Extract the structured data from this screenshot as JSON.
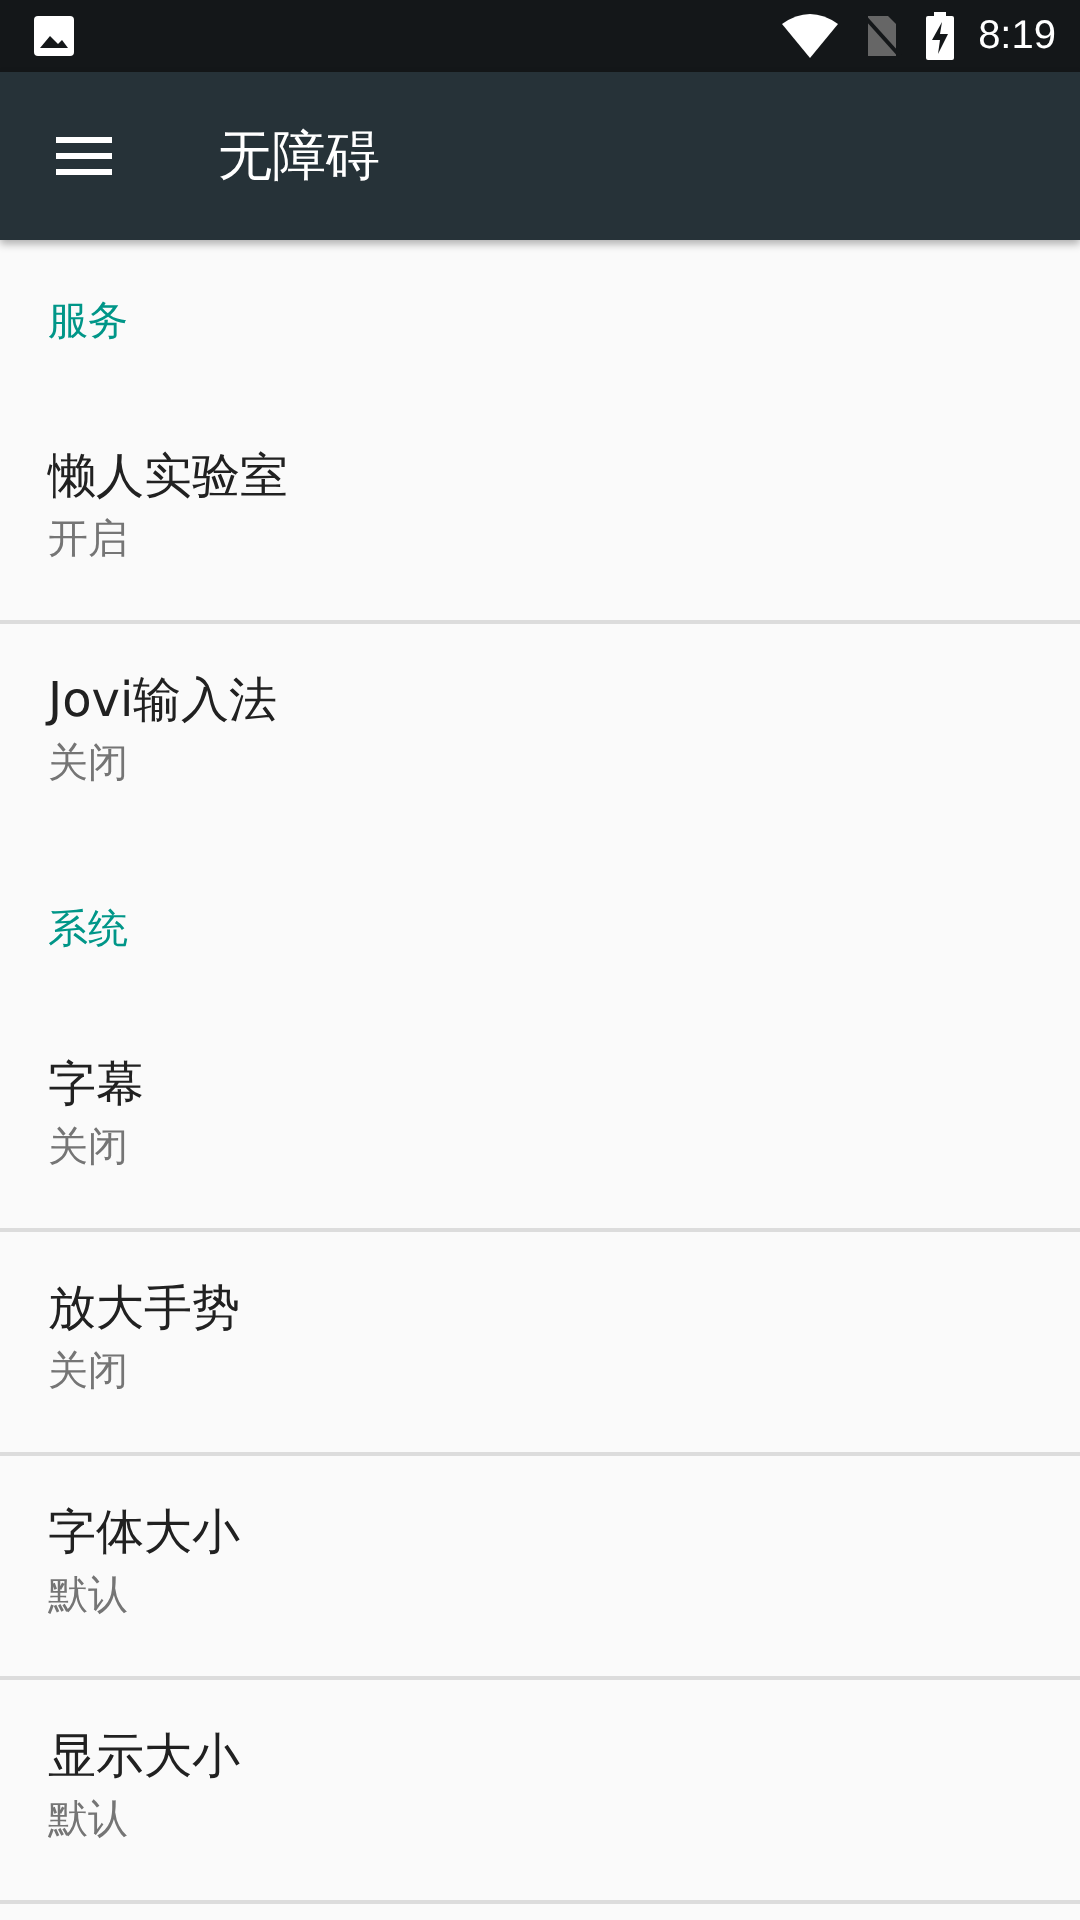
{
  "status_bar": {
    "time": "8:19"
  },
  "toolbar": {
    "title": "无障碍"
  },
  "sections": [
    {
      "title": "服务",
      "items": [
        {
          "title": "懒人实验室",
          "summary": "开启"
        },
        {
          "title": "Jovi输入法",
          "summary": "关闭"
        }
      ]
    },
    {
      "title": "系统",
      "items": [
        {
          "title": "字幕",
          "summary": "关闭"
        },
        {
          "title": "放大手势",
          "summary": "关闭"
        },
        {
          "title": "字体大小",
          "summary": "默认"
        },
        {
          "title": "显示大小",
          "summary": "默认"
        }
      ]
    }
  ]
}
